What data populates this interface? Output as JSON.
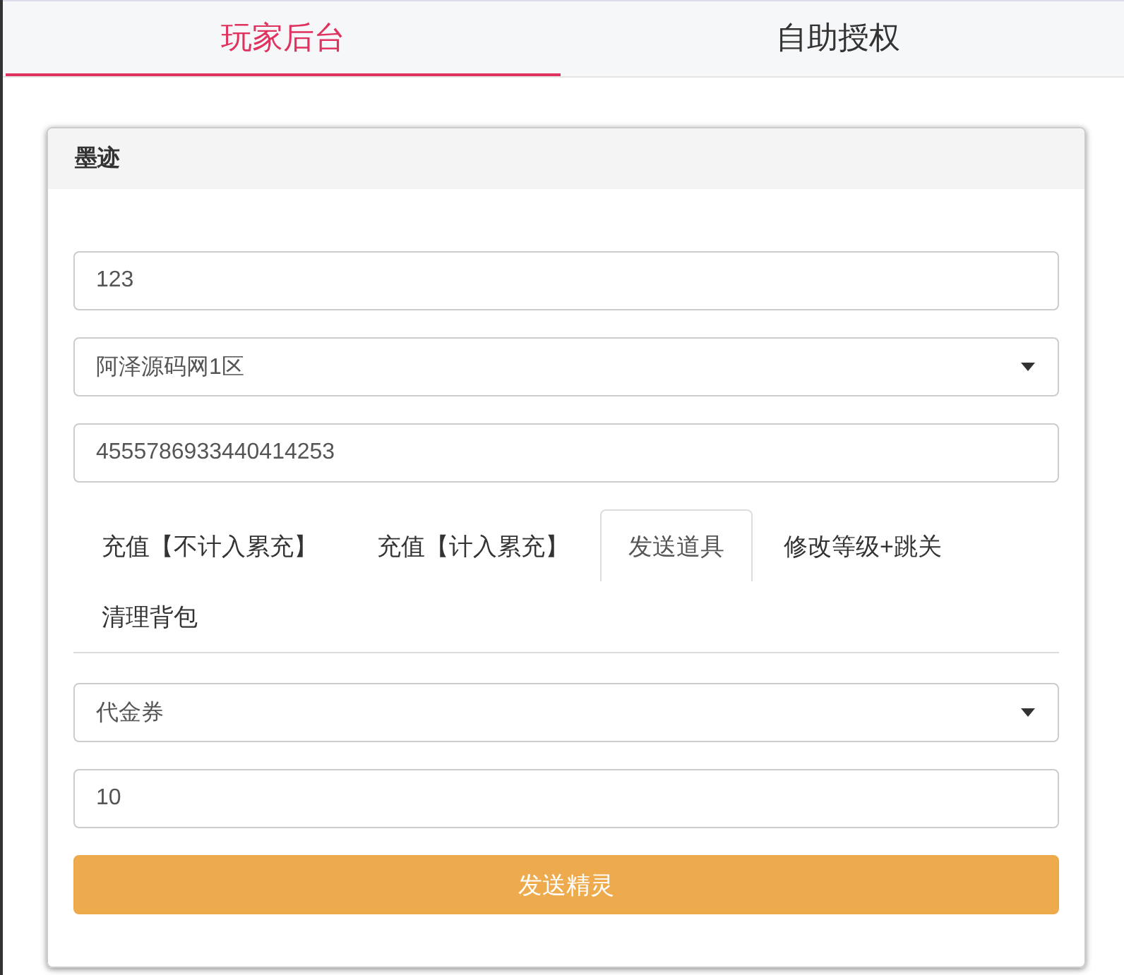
{
  "top_tabs": [
    {
      "label": "玩家后台",
      "selected": true
    },
    {
      "label": "自助授权",
      "selected": false
    }
  ],
  "panel": {
    "title": "墨迹",
    "fields": [
      {
        "kind": "input",
        "value": "123"
      },
      {
        "kind": "select",
        "value": "阿泽源码网1区"
      },
      {
        "kind": "input",
        "value": "4555786933440414253"
      }
    ],
    "tabs": [
      {
        "label": "充值【不计入累充】",
        "selected": false
      },
      {
        "label": "充值【计入累充】",
        "selected": false
      },
      {
        "label": "发送道具",
        "selected": true
      },
      {
        "label": "修改等级+跳关",
        "selected": false
      },
      {
        "label": "清理背包",
        "selected": false
      }
    ],
    "form": [
      {
        "kind": "select",
        "value": "代金券"
      },
      {
        "kind": "input",
        "value": "10"
      }
    ],
    "button": "发送精灵"
  }
}
